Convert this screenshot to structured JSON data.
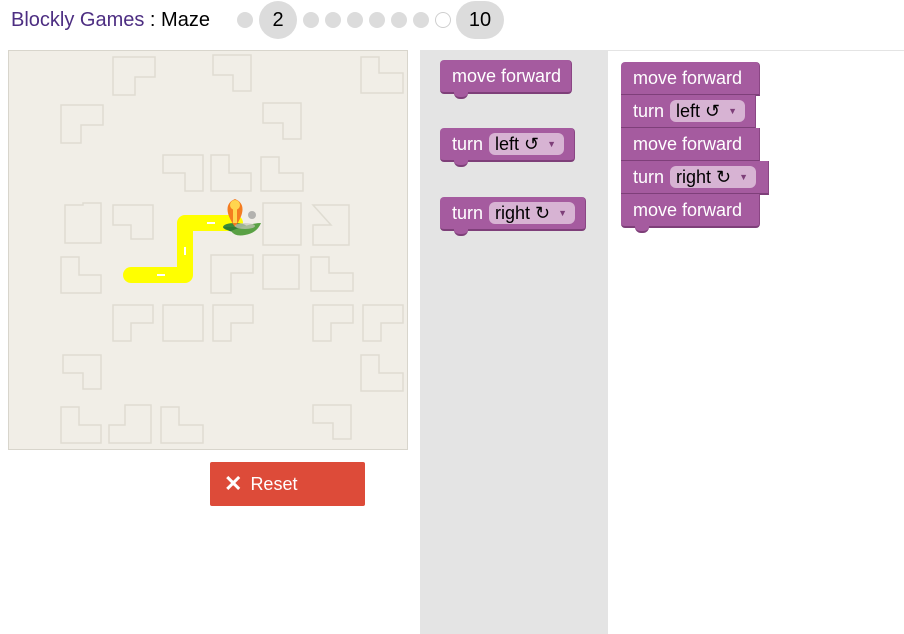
{
  "header": {
    "app_name": "Blockly Games",
    "separator": " : ",
    "game_name": "Maze",
    "levels": {
      "current": "2",
      "last": "10",
      "dots_after_current": 6
    }
  },
  "reset_button": {
    "label": "Reset",
    "icon": "close-icon"
  },
  "toolbox": {
    "blocks": [
      {
        "type": "move",
        "label": "move forward"
      },
      {
        "type": "turn",
        "label": "turn",
        "option": "left ↺"
      },
      {
        "type": "turn",
        "label": "turn",
        "option": "right ↻"
      }
    ]
  },
  "workspace": {
    "program": [
      {
        "type": "move",
        "label": "move forward"
      },
      {
        "type": "turn",
        "label": "turn",
        "option": "left ↺"
      },
      {
        "type": "move",
        "label": "move forward"
      },
      {
        "type": "turn",
        "label": "turn",
        "option": "right ↻"
      },
      {
        "type": "move",
        "label": "move forward"
      }
    ]
  },
  "colors": {
    "block": "#a55b9f",
    "path": "#ffff00",
    "reset": "#dd4b39",
    "app_name": "#4d2e82"
  }
}
